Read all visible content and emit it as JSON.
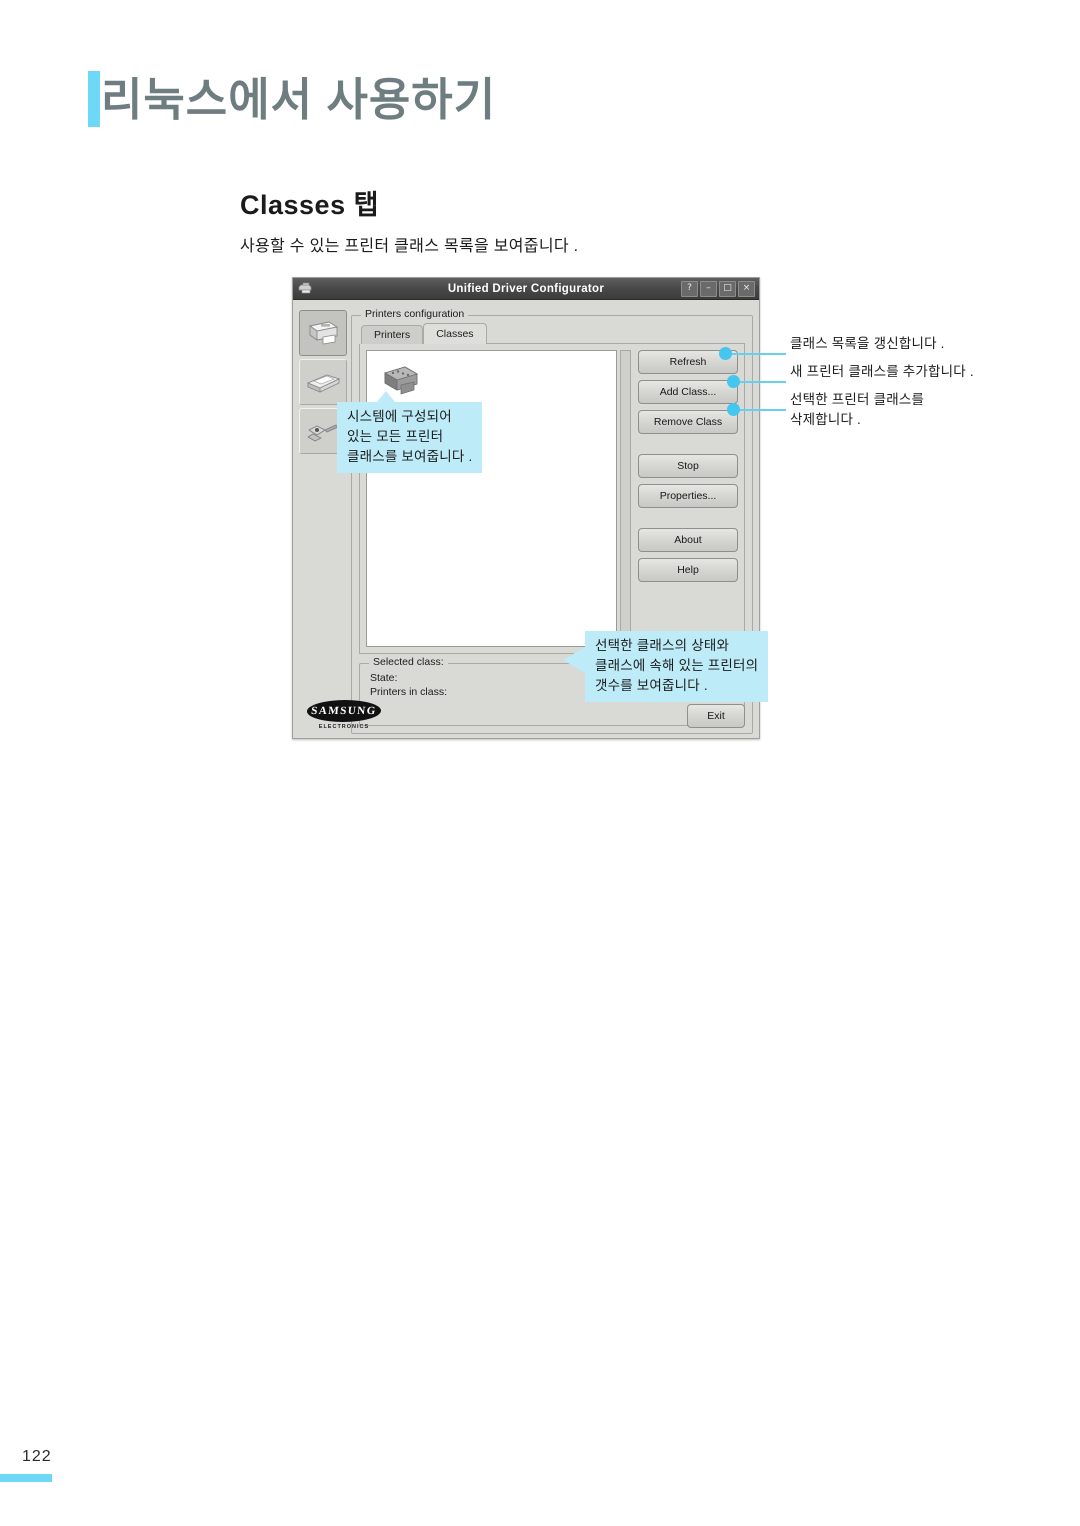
{
  "page": {
    "chapter_title": "리눅스에서 사용하기",
    "section_heading": "Classes 탭",
    "section_description": "사용할 수 있는 프린터 클래스 목록을 보여줍니다 .",
    "page_number": "122",
    "accent_color": "#6ED8F7",
    "callout_bg": "#BDEBF7",
    "heading_color": "#6E7D80"
  },
  "dialog": {
    "titlebar": {
      "app_icon": "printer-icon",
      "title": "Unified Driver Configurator",
      "buttons": [
        {
          "name": "help-button",
          "glyph": "?"
        },
        {
          "name": "minimize-button",
          "glyph": "–"
        },
        {
          "name": "maximize-button",
          "glyph": "□"
        },
        {
          "name": "close-button",
          "glyph": "×"
        }
      ]
    },
    "rail": [
      {
        "name": "printers-configuration-icon",
        "icon": "printer-icon",
        "active": true
      },
      {
        "name": "scanners-configuration-icon",
        "icon": "scanner-icon",
        "active": false
      },
      {
        "name": "ports-configuration-icon",
        "icon": "port-plug-icon",
        "active": false
      }
    ],
    "groupbox_title": "Printers configuration",
    "tabs": [
      {
        "label": "Printers",
        "selected": false
      },
      {
        "label": "Classes",
        "selected": true
      }
    ],
    "list": {
      "items": [
        {
          "icon": "printer-class-icon",
          "label": ""
        }
      ]
    },
    "buttons": [
      {
        "label": "Refresh",
        "annotated": true
      },
      {
        "label": "Add Class...",
        "annotated": true
      },
      {
        "label": "Remove Class",
        "annotated": true
      },
      {
        "label": "Stop",
        "annotated": false
      },
      {
        "label": "Properties...",
        "annotated": false
      },
      {
        "label": "About",
        "annotated": false
      },
      {
        "label": "Help",
        "annotated": false
      }
    ],
    "selected_class": {
      "group_title": "Selected class:",
      "fields": [
        {
          "label": "State:",
          "value": ""
        },
        {
          "label": "Printers in class:",
          "value": ""
        }
      ]
    },
    "footer": {
      "brand": "SAMSUNG",
      "brand_sub": "ELECTRONICS",
      "exit_label": "Exit"
    }
  },
  "callouts": {
    "list": "시스템에 구성되어\n있는 모든 프린터\n클래스를 보여줍니다 .",
    "selected": "선택한 클래스의 상태와\n클래스에 속해 있는 프린터의\n갯수를 보여줍니다 ."
  },
  "annotations": [
    {
      "text": "클래스 목록을 갱신합니다 ."
    },
    {
      "text": "새 프린터 클래스를 추가합니다 ."
    },
    {
      "text": "선택한 프린터 클래스를\n삭제합니다 ."
    }
  ]
}
